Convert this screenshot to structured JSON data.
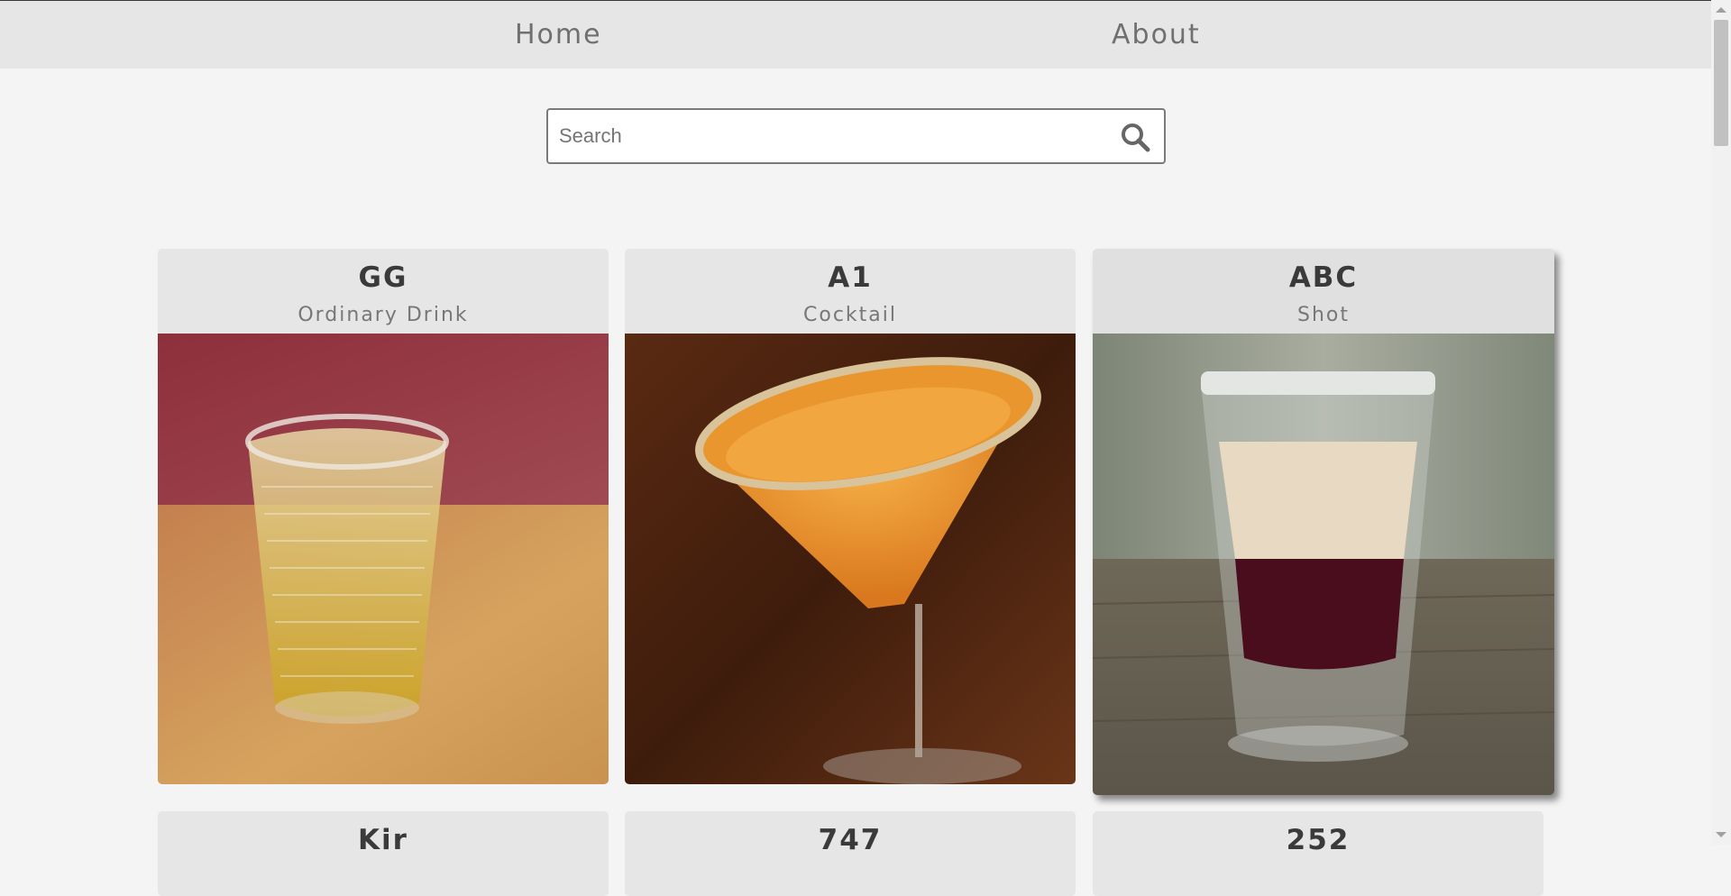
{
  "nav": {
    "home_label": "Home",
    "about_label": "About"
  },
  "search": {
    "placeholder": "Search",
    "value": ""
  },
  "drinks": [
    {
      "name": "GG",
      "category": "Ordinary Drink"
    },
    {
      "name": "A1",
      "category": "Cocktail"
    },
    {
      "name": "ABC",
      "category": "Shot"
    },
    {
      "name": "Kir",
      "category": ""
    },
    {
      "name": "747",
      "category": ""
    },
    {
      "name": "252",
      "category": ""
    }
  ],
  "colors": {
    "navbar_bg": "#e6e6e6",
    "page_bg": "#f4f4f4",
    "card_header_bg": "#e6e6e6",
    "nav_text": "#707070"
  },
  "icons": {
    "search": "magnifying-glass"
  }
}
